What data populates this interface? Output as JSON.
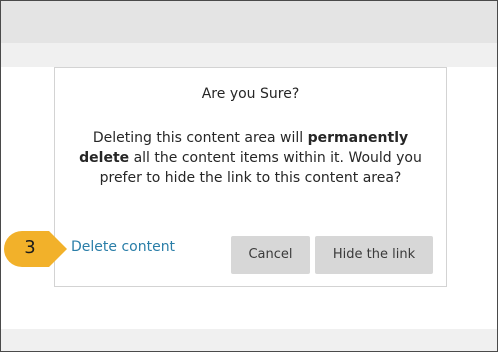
{
  "dialog": {
    "title": "Are you Sure?",
    "message_part1": "Deleting this content area will ",
    "message_bold1": "permanently delete",
    "message_part2": " all the content items within it. Would you prefer to hide the link to this content area?",
    "delete_link": "Delete content",
    "cancel_label": "Cancel",
    "hide_label": "Hide the link"
  },
  "step_badge": {
    "number": "3",
    "color": "#f2b12a"
  },
  "colors": {
    "link": "#2a7ea8",
    "button_bg": "#d7d7d7",
    "top_bar": "#e4e4e4"
  }
}
